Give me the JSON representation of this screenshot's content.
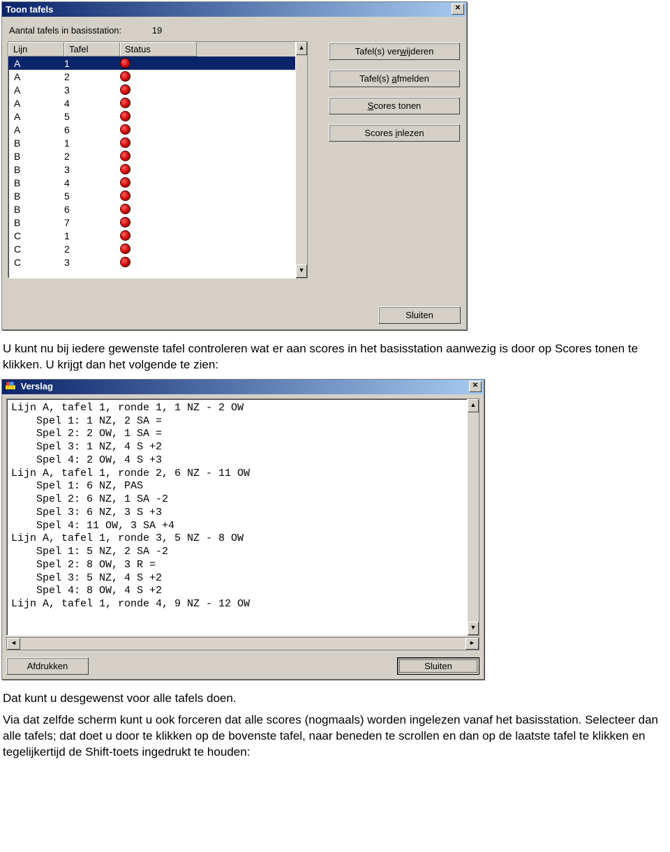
{
  "toon": {
    "title": "Toon tafels",
    "stat_label": "Aantal tafels in basisstation:",
    "stat_value": "19",
    "headers": {
      "lijn": "Lijn",
      "tafel": "Tafel",
      "status": "Status"
    },
    "rows": [
      {
        "lijn": "A",
        "tafel": "1",
        "selected": true
      },
      {
        "lijn": "A",
        "tafel": "2"
      },
      {
        "lijn": "A",
        "tafel": "3"
      },
      {
        "lijn": "A",
        "tafel": "4"
      },
      {
        "lijn": "A",
        "tafel": "5"
      },
      {
        "lijn": "A",
        "tafel": "6"
      },
      {
        "lijn": "B",
        "tafel": "1"
      },
      {
        "lijn": "B",
        "tafel": "2"
      },
      {
        "lijn": "B",
        "tafel": "3"
      },
      {
        "lijn": "B",
        "tafel": "4"
      },
      {
        "lijn": "B",
        "tafel": "5"
      },
      {
        "lijn": "B",
        "tafel": "6"
      },
      {
        "lijn": "B",
        "tafel": "7"
      },
      {
        "lijn": "C",
        "tafel": "1"
      },
      {
        "lijn": "C",
        "tafel": "2"
      },
      {
        "lijn": "C",
        "tafel": "3"
      }
    ],
    "buttons": {
      "verwijderen_pre": "Tafel(s) ver",
      "verwijderen_u": "w",
      "verwijderen_post": "ijderen",
      "afmelden_pre": "Tafel(s) ",
      "afmelden_u": "a",
      "afmelden_post": "fmelden",
      "scores_tonen_u": "S",
      "scores_tonen_post": "cores tonen",
      "scores_inlezen_pre": "Scores ",
      "scores_inlezen_u": "i",
      "scores_inlezen_post": "nlezen",
      "sluiten": "Sluiten"
    }
  },
  "para1": "U kunt nu bij iedere gewenste tafel controleren wat er aan scores in het basisstation aanwezig is door op Scores tonen te klikken. U krijgt dan het volgende te zien:",
  "verslag": {
    "title": "Verslag",
    "lines": [
      "Lijn A, tafel 1, ronde 1, 1 NZ - 2 OW",
      "    Spel 1: 1 NZ, 2 SA =",
      "    Spel 2: 2 OW, 1 SA =",
      "    Spel 3: 1 NZ, 4 S +2",
      "    Spel 4: 2 OW, 4 S +3",
      "Lijn A, tafel 1, ronde 2, 6 NZ - 11 OW",
      "    Spel 1: 6 NZ, PAS",
      "    Spel 2: 6 NZ, 1 SA -2",
      "    Spel 3: 6 NZ, 3 S +3",
      "    Spel 4: 11 OW, 3 SA +4",
      "Lijn A, tafel 1, ronde 3, 5 NZ - 8 OW",
      "    Spel 1: 5 NZ, 2 SA -2",
      "    Spel 2: 8 OW, 3 R =",
      "    Spel 3: 5 NZ, 4 S +2",
      "    Spel 4: 8 OW, 4 S +2",
      "Lijn A, tafel 1, ronde 4, 9 NZ - 12 OW"
    ],
    "buttons": {
      "afdrukken": "Afdrukken",
      "sluiten": "Sluiten"
    }
  },
  "para2": "Dat kunt u desgewenst voor alle tafels doen.",
  "para3": "Via dat zelfde scherm kunt u ook forceren dat alle scores (nogmaals) worden ingelezen vanaf het basisstation. Selecteer dan alle tafels; dat doet u door te klikken op de bovenste tafel, naar beneden te scrollen en dan op de laatste tafel te klikken en tegelijkertijd de Shift-toets ingedrukt te houden:"
}
